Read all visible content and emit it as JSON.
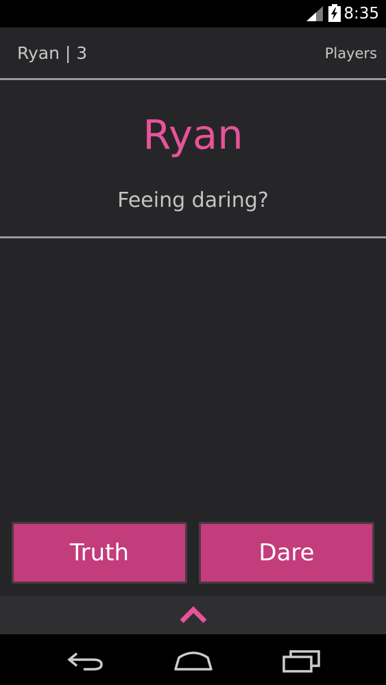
{
  "status_bar": {
    "time": "8:35",
    "icons": [
      "signal-icon",
      "battery-charging-icon"
    ]
  },
  "action_bar": {
    "title": "Ryan | 3",
    "players_label": "Players"
  },
  "header": {
    "player_name": "Ryan",
    "prompt": "Feeing daring?"
  },
  "buttons": {
    "truth_label": "Truth",
    "dare_label": "Dare"
  },
  "bottom_tab": {
    "icon": "chevron-up-icon"
  },
  "nav_bar": {
    "icons": [
      "back-icon",
      "home-icon",
      "recents-icon"
    ]
  },
  "colors": {
    "accent": "#e8539a",
    "button": "#c33c7b",
    "background": "#252527"
  }
}
